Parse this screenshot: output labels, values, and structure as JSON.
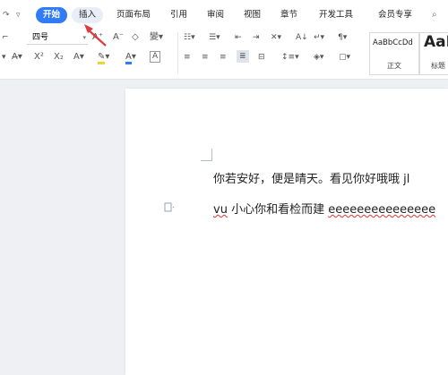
{
  "topbar": {
    "left_icon_1": "redo-icon",
    "left_icon_2": "customize-dropdown-icon",
    "tabs": [
      "开始",
      "插入",
      "页面布局",
      "引用",
      "审阅",
      "视图",
      "章节",
      "开发工具",
      "会员专享"
    ],
    "active_tab": "开始",
    "highlighted_tab": "插入",
    "search_icon": "search-icon"
  },
  "ribbon": {
    "font_size": "四号",
    "font_size_dropdown": "▾",
    "style_normal_sample": "AaBbCcDd",
    "style_normal_label": "正文",
    "style_heading_sample": "AaB",
    "style_heading_label": "标题"
  },
  "document": {
    "line1": "你若安好，便是晴天。看见你好哦哦 jl",
    "line2_part1": "vu",
    "line2_part2": " 小心你和看检而建 ",
    "line2_part3": "eeeeeeeeeeeeeee"
  },
  "colors": {
    "accent": "#2f7cf6",
    "arrow": "#e0393e",
    "spell_underline": "#d33"
  }
}
